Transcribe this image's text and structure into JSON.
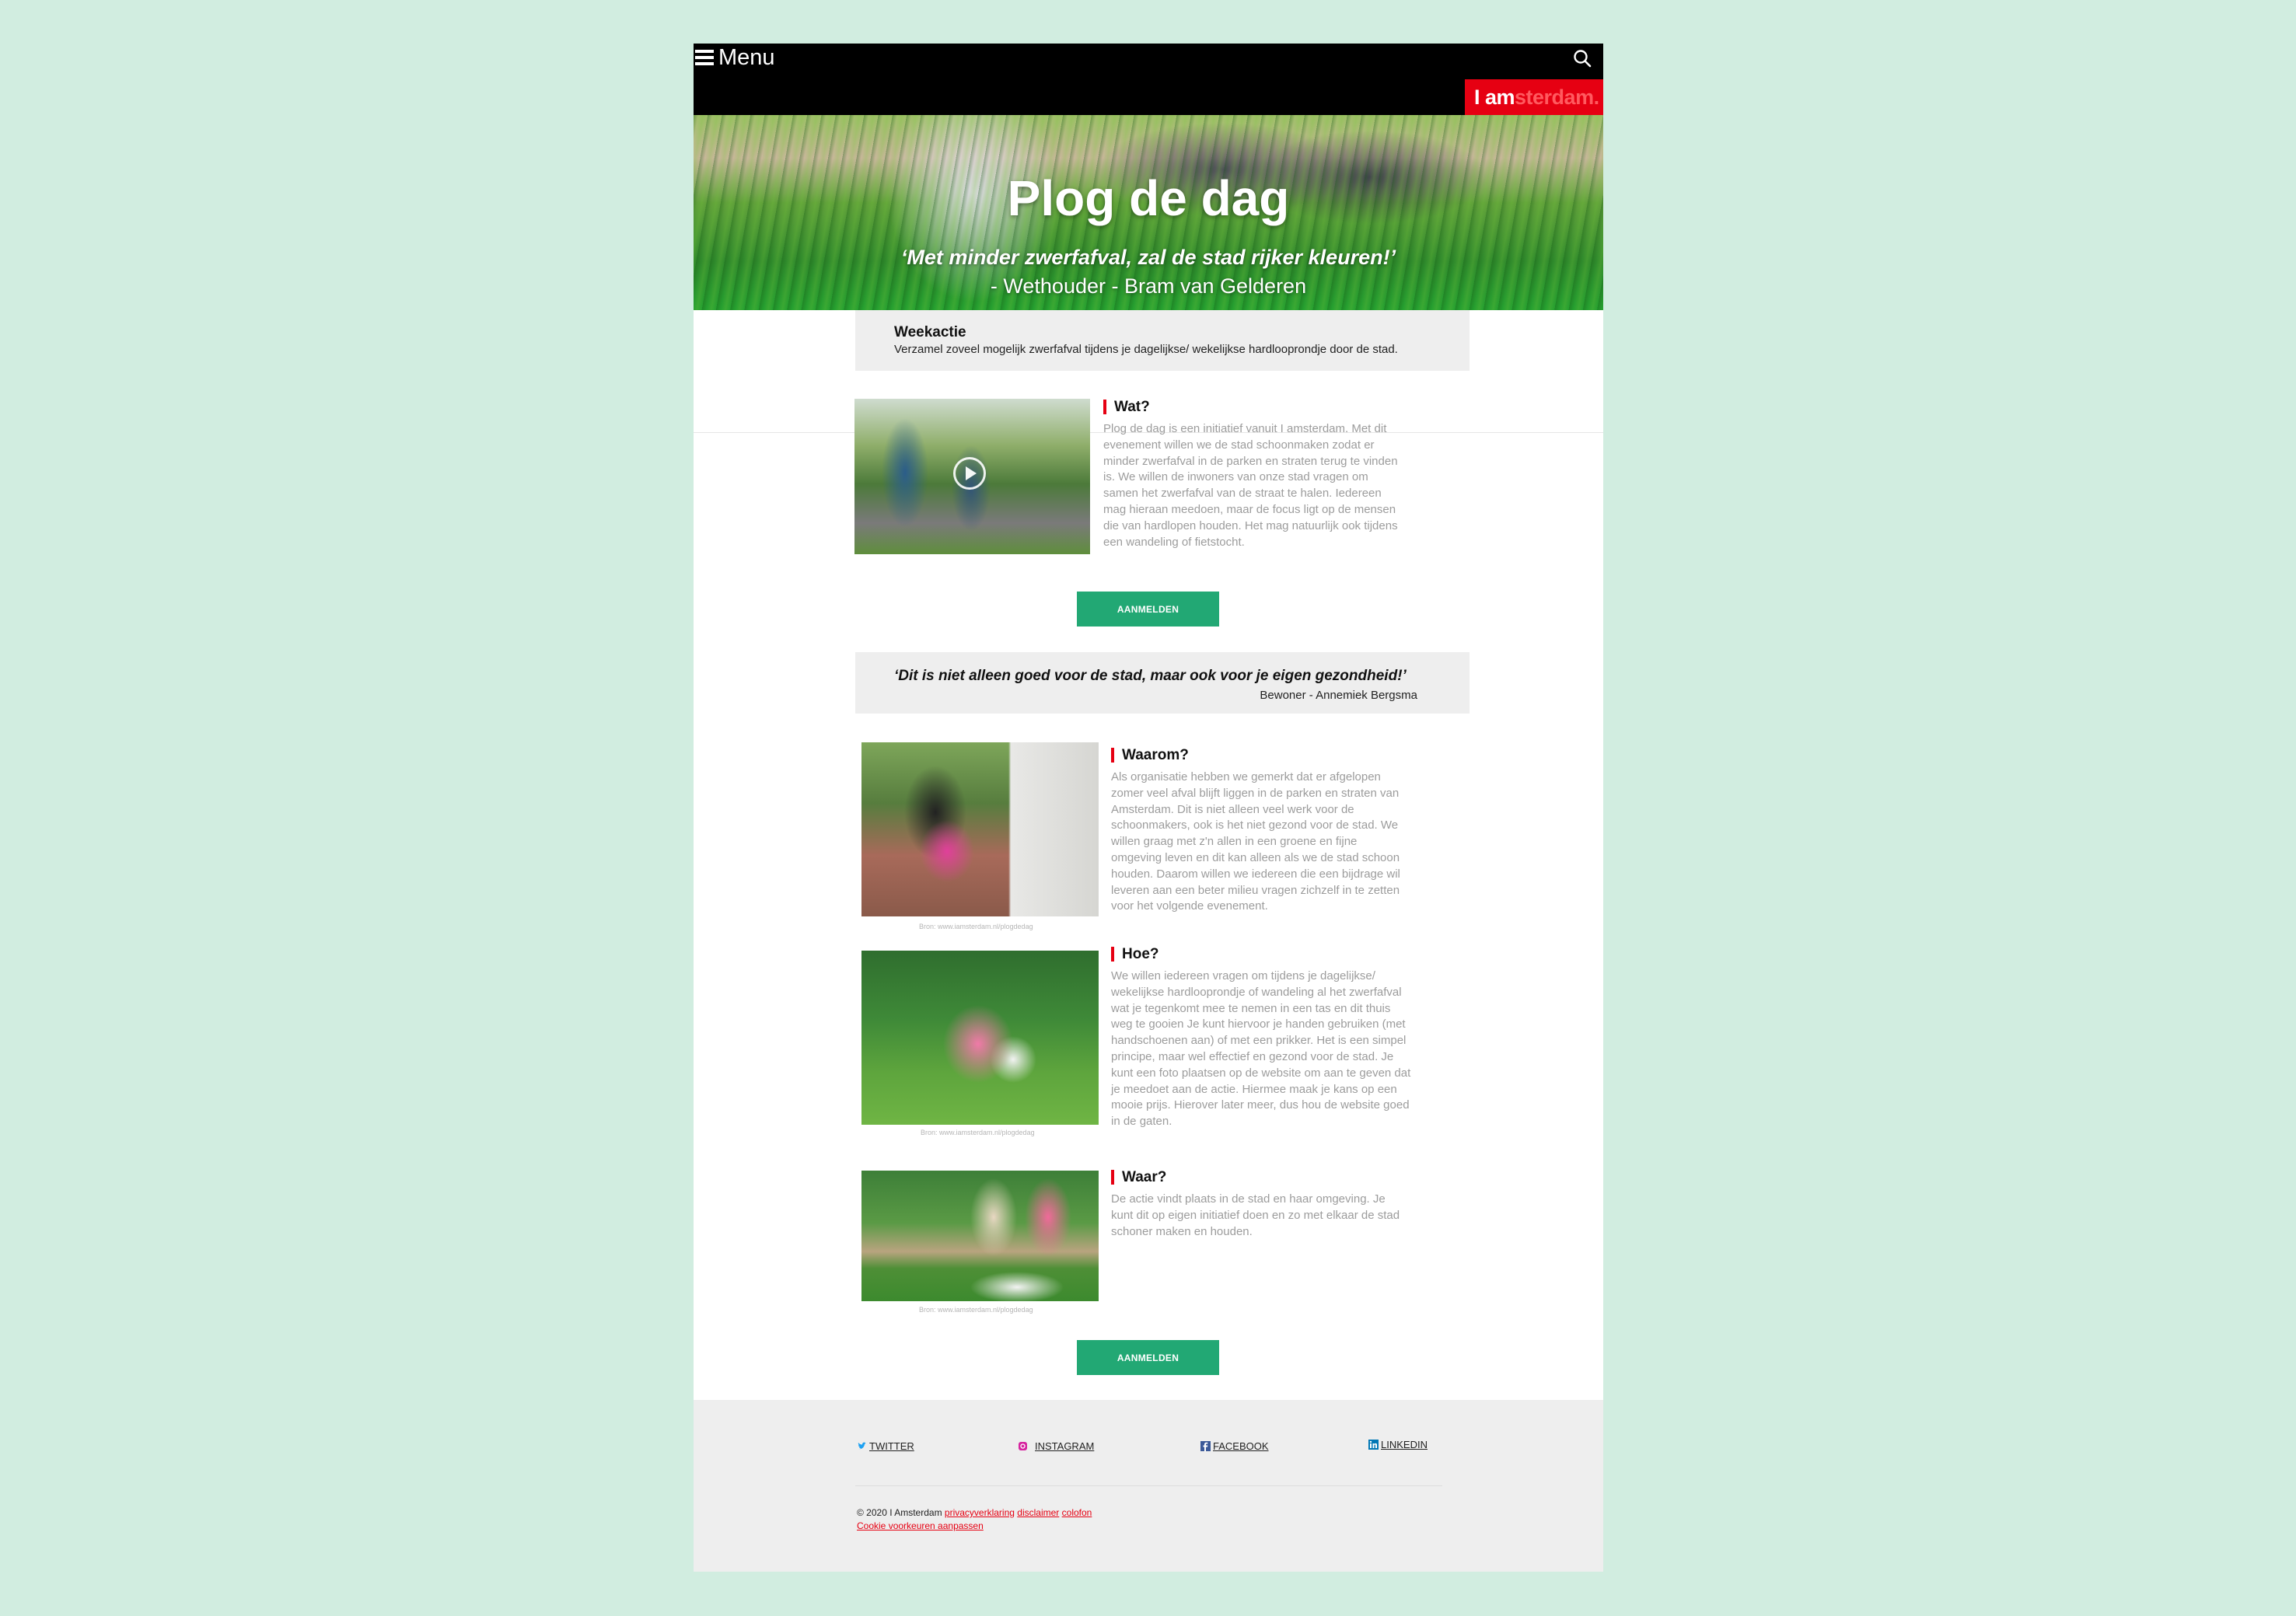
{
  "header": {
    "menu_label": "Menu",
    "logo_part1": "I am",
    "logo_part2": "sterdam."
  },
  "hero": {
    "title": "Plog de dag",
    "quote": "‘Met minder zwerfafval, zal de stad rijker kleuren!’",
    "author": "- Wethouder - Bram van Gelderen"
  },
  "weekactie": {
    "title": "Weekactie",
    "text": "Verzamel zoveel mogelijk zwerfafval tijdens je dagelijkse/ wekelijkse hardlooprondje door de stad."
  },
  "sections": {
    "wat": {
      "title": "Wat?",
      "text": "Plog de dag is een initiatief vanuit I amsterdam. Met dit\nevenement willen we de stad schoonmaken zodat er\nminder zwerfafval in de parken en straten terug te vinden\nis. We willen de inwoners van onze stad vragen om\nsamen het zwerfafval van de straat te halen. Iedereen\nmag hieraan meedoen, maar de focus ligt op de mensen\ndie van hardlopen houden. Het mag natuurlijk ook tijdens\neen wandeling of fietstocht."
    },
    "waarom": {
      "title": "Waarom?",
      "text": "Als organisatie hebben we gemerkt dat er afgelopen\nzomer veel afval blijft liggen in de parken en straten van\nAmsterdam. Dit is niet alleen veel werk voor de\nschoonmakers, ook is het niet gezond voor de stad. We\nwillen graag met z'n allen in een groene en fijne\nomgeving leven en dit kan alleen als we de stad schoon\nhouden. Daarom willen we iedereen die een bijdrage wil\nleveren aan een beter milieu vragen zichzelf in te zetten\nvoor het volgende evenement.",
      "caption": "Bron: www.iamsterdam.nl/plogdedag"
    },
    "hoe": {
      "title": "Hoe?",
      "text": "We willen iedereen vragen om tijdens je dagelijkse/\nwekelijkse hardlooprondje of wandeling al het zwerfafval\nwat je tegenkomt mee te nemen in een tas en dit thuis\nweg te gooien Je kunt hiervoor je handen gebruiken (met\nhandschoenen aan) of met een prikker. Het is een simpel\nprincipe, maar wel effectief en gezond voor de stad. Je\nkunt een foto plaatsen op de website om aan te geven dat\nje meedoet aan de actie. Hiermee maak je kans op een\nmooie prijs. Hierover later meer, dus hou de website goed\nin de gaten.",
      "caption": "Bron: www.iamsterdam.nl/plogdedag"
    },
    "waar": {
      "title": "Waar?",
      "text": "De actie vindt plaats in de stad en haar omgeving. Je\nkunt dit op eigen initiatief doen en zo met elkaar de stad\nschoner maken en houden.",
      "caption": "Bron: www.iamsterdam.nl/plogdedag"
    }
  },
  "buttons": {
    "signup_label": "AANMELDEN"
  },
  "quote2": {
    "text": "‘Dit is niet alleen goed voor de stad, maar ook voor je eigen gezondheid!’",
    "author": "Bewoner - Annemiek Bergsma"
  },
  "footer": {
    "social": [
      "TWITTER",
      "INSTAGRAM",
      "FACEBOOK",
      "LINKEDIN"
    ],
    "copyright": "© 2020 I Amsterdam",
    "links": [
      "privacyverklaring",
      "disclaimer",
      "colofon"
    ],
    "cookie": "Cookie voorkeuren aanpassen"
  },
  "colors": {
    "brand_red": "#e60012",
    "button_green": "#22a874",
    "background": "#d1ede0"
  },
  "icons": [
    "menu-icon",
    "search-icon",
    "play-icon",
    "twitter-icon",
    "instagram-icon",
    "facebook-icon",
    "linkedin-icon"
  ]
}
